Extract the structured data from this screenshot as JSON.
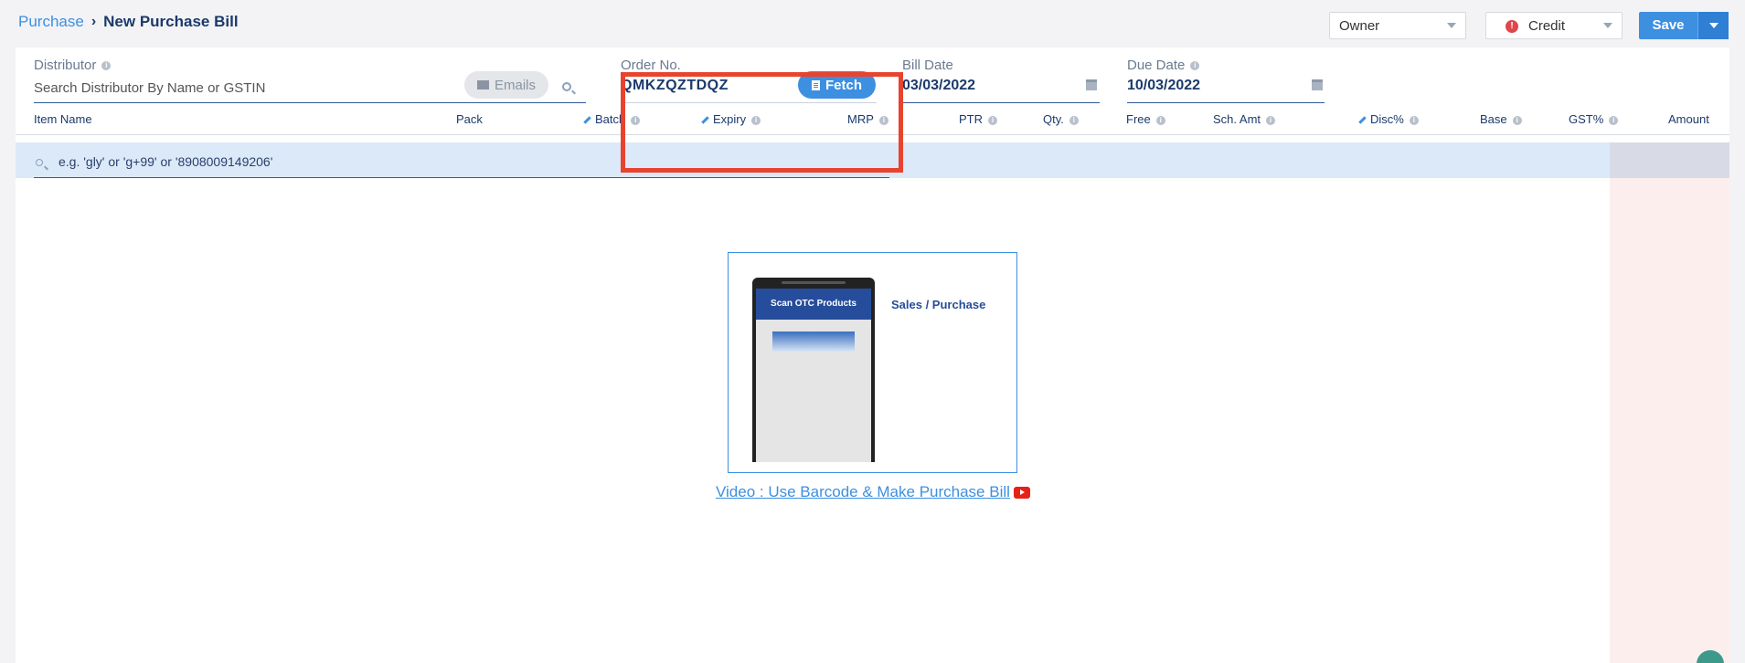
{
  "breadcrumb": {
    "parent": "Purchase",
    "current": "New Purchase Bill"
  },
  "header": {
    "role_select": "Owner",
    "payment_select": "Credit",
    "save_label": "Save"
  },
  "form": {
    "distributor": {
      "label": "Distributor",
      "placeholder": "Search Distributor By Name or GSTIN",
      "emails_label": "Emails"
    },
    "order": {
      "label": "Order No.",
      "value": "QMKZQZTDQZ",
      "fetch_label": "Fetch"
    },
    "bill_date": {
      "label": "Bill Date",
      "value": "03/03/2022"
    },
    "due_date": {
      "label": "Due Date",
      "value": "10/03/2022"
    }
  },
  "table": {
    "columns": [
      "Item Name",
      "Pack",
      "Batch",
      "Expiry",
      "MRP",
      "PTR",
      "Qty.",
      "Free",
      "Sch. Amt",
      "Disc%",
      "Base",
      "GST%",
      "Amount"
    ],
    "item_search_placeholder": "e.g. 'gly' or 'g+99' or '8908009149206'"
  },
  "promo": {
    "phone_header": "Scan OTC Products",
    "side_label": "Sales / Purchase",
    "video_link": "Video : Use Barcode & Make Purchase Bill"
  },
  "colors": {
    "accent": "#3d8fe0",
    "highlight": "#e8432f",
    "navy": "#1b3a6b"
  }
}
